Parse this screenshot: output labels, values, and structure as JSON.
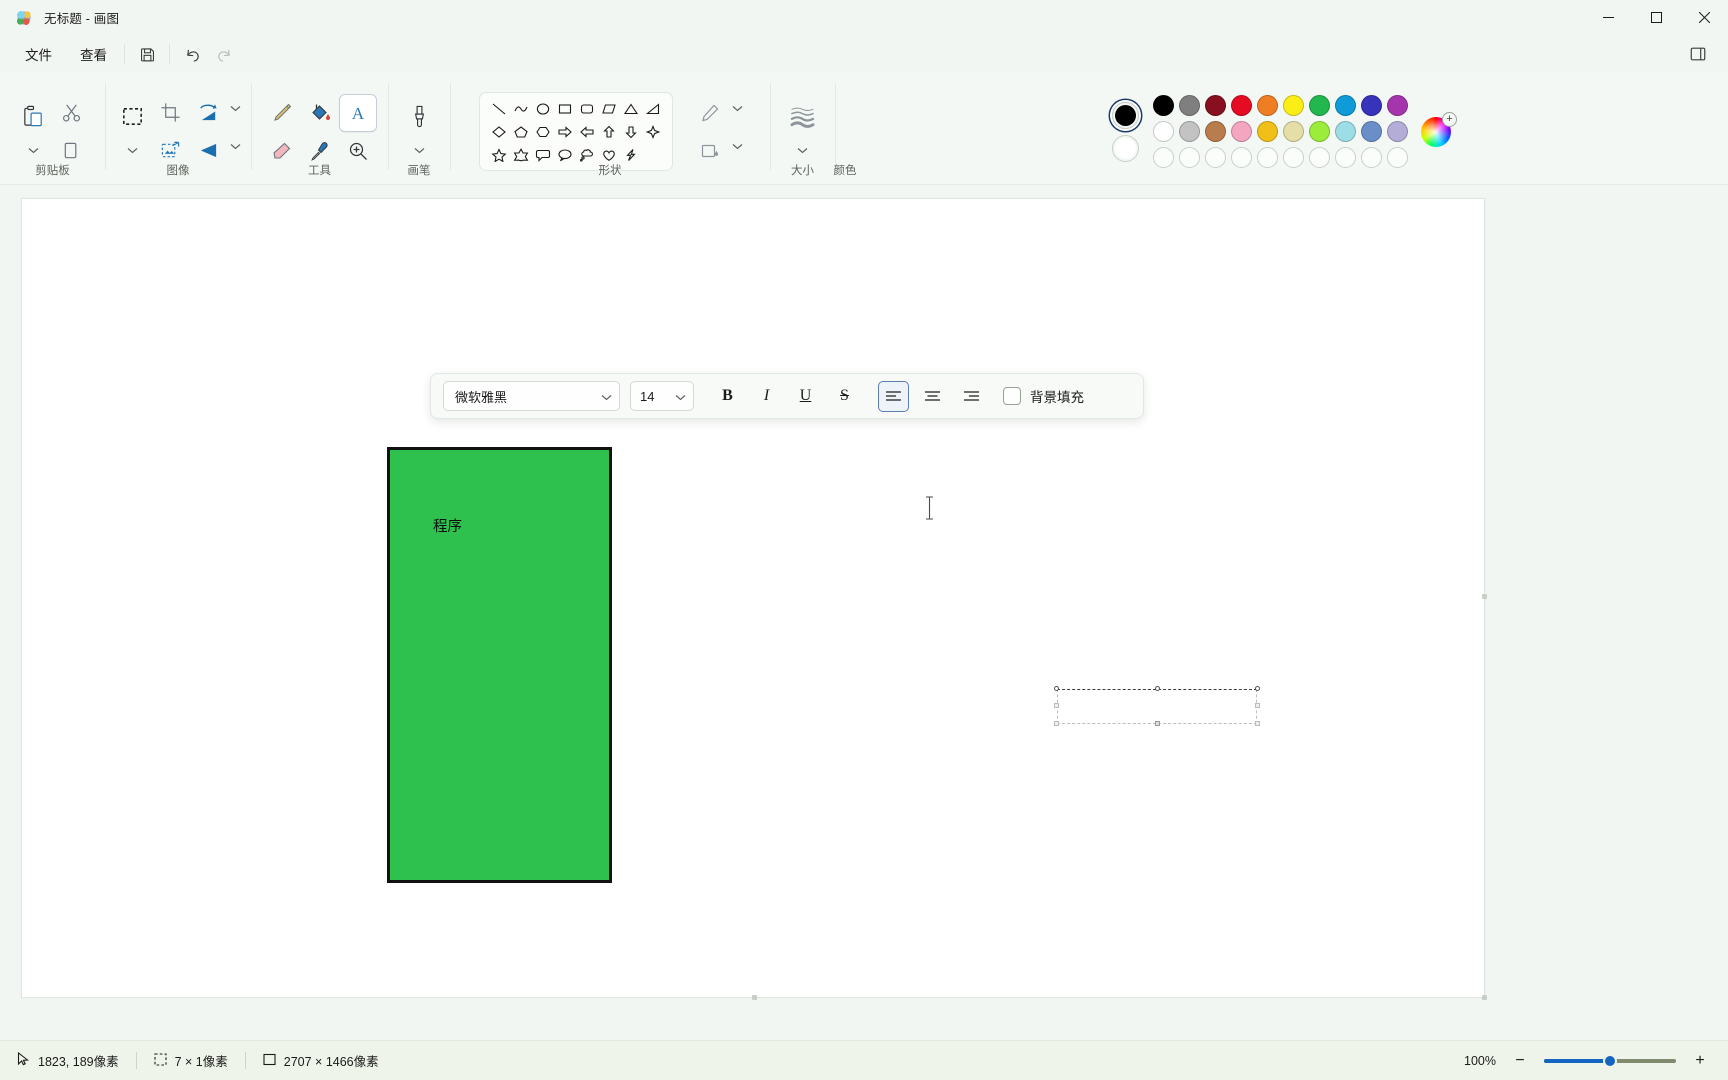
{
  "window": {
    "title": "无标题 - 画图",
    "app_icon": "paint-palette-icon",
    "minimize": "—",
    "maximize": "□",
    "close": "✕"
  },
  "menu": {
    "items": [
      {
        "label": "文件",
        "name": "menu-file"
      },
      {
        "label": "查看",
        "name": "menu-view"
      }
    ],
    "quick_access": [
      {
        "name": "save-icon",
        "label": "保存",
        "disabled": false
      },
      {
        "name": "undo-icon",
        "label": "撤消",
        "disabled": false
      },
      {
        "name": "redo-icon",
        "label": "恢复",
        "disabled": true
      }
    ],
    "right": [
      {
        "name": "collapse-ribbon-icon",
        "label": ""
      }
    ]
  },
  "ribbon": {
    "groups": [
      {
        "label": "剪贴板",
        "name": "group-clipboard",
        "buttons": [
          {
            "name": "paste-icon",
            "label": "粘贴"
          },
          {
            "name": "cut-icon",
            "label": "剪切"
          },
          {
            "name": "copy-icon",
            "label": "复制"
          },
          {
            "name": "paste-dropdown-chevron-icon",
            "label": ""
          }
        ]
      },
      {
        "label": "图像",
        "name": "group-image",
        "buttons": [
          {
            "name": "rect-select-icon",
            "label": "选择"
          },
          {
            "name": "select-dropdown-chevron-icon",
            "label": ""
          },
          {
            "name": "crop-icon",
            "label": "裁剪"
          },
          {
            "name": "resize-icon",
            "label": "调整大小"
          },
          {
            "name": "rotate-icon",
            "label": "旋转"
          },
          {
            "name": "rotate-dropdown-chevron-icon",
            "label": ""
          },
          {
            "name": "flip-icon",
            "label": "翻转"
          },
          {
            "name": "flip-dropdown-chevron-icon",
            "label": ""
          }
        ]
      },
      {
        "label": "工具",
        "name": "group-tools",
        "buttons": [
          {
            "name": "pencil-icon",
            "label": "铅笔"
          },
          {
            "name": "fill-bucket-icon",
            "label": "用颜色填充"
          },
          {
            "name": "text-icon",
            "label": "文本",
            "active": true
          },
          {
            "name": "eraser-icon",
            "label": "橡皮擦"
          },
          {
            "name": "eyedropper-icon",
            "label": "颜色选取器"
          },
          {
            "name": "magnifier-icon",
            "label": "放大镜"
          }
        ]
      },
      {
        "label": "画笔",
        "name": "group-brushes",
        "buttons": [
          {
            "name": "brushes-icon",
            "label": "画笔"
          },
          {
            "name": "brushes-dropdown-chevron-icon",
            "label": ""
          }
        ]
      },
      {
        "label": "形状",
        "name": "group-shapes",
        "shape_rows": [
          [
            "line",
            "curve",
            "oval",
            "rectangle",
            "rounded-rectangle",
            "parallelogram",
            "triangle",
            "right-triangle"
          ],
          [
            "diamond",
            "pentagon",
            "hexagon",
            "right-arrow",
            "left-arrow",
            "up-arrow",
            "down-arrow",
            "four-point-star"
          ],
          [
            "five-point-star",
            "six-point-star",
            "rounded-callout",
            "oval-callout",
            "cloud-callout",
            "heart",
            "lightning"
          ]
        ],
        "buttons": [
          {
            "name": "shape-outline-icon",
            "label": "轮廓"
          },
          {
            "name": "shape-outline-chevron-icon",
            "label": ""
          },
          {
            "name": "shape-fill-icon",
            "label": "填充"
          },
          {
            "name": "shape-fill-chevron-icon",
            "label": ""
          }
        ]
      },
      {
        "label": "大小",
        "name": "group-size",
        "buttons": [
          {
            "name": "size-icon",
            "label": "大小"
          },
          {
            "name": "size-chevron-icon",
            "label": ""
          }
        ]
      },
      {
        "label": "颜色",
        "name": "group-colors"
      }
    ]
  },
  "colors": {
    "primary": "#000000",
    "secondary": "#ffffff",
    "primary_selected": true,
    "row1": [
      "#000000",
      "#7f7f7f",
      "#870f20",
      "#e40b22",
      "#ef7d24",
      "#fbee17",
      "#23b74f",
      "#0e9bd8",
      "#3733bb",
      "#a535ad"
    ],
    "row2": [
      "#ffffff",
      "#c3c3c3",
      "#b97c4c",
      "#f4a5c0",
      "#f0c018",
      "#e5dea7",
      "#9ced3b",
      "#9ddde5",
      "#6a8fc8",
      "#b3add8"
    ],
    "row3": [
      "",
      "",
      "",
      "",
      "",
      "",
      "",
      "",
      "",
      ""
    ],
    "wheel": {
      "name": "color-wheel-icon",
      "badge": "+"
    }
  },
  "text_toolbar": {
    "font_family": "微软雅黑",
    "font_size": "14",
    "bold": {
      "label": "B",
      "name": "bold-button",
      "active": false
    },
    "italic": {
      "label": "I",
      "name": "italic-button",
      "active": false
    },
    "underline": {
      "label": "U",
      "name": "underline-button",
      "active": false
    },
    "strikethrough": {
      "label": "S",
      "name": "strikethrough-button",
      "active": false
    },
    "align_left": {
      "name": "align-left-button",
      "active": true
    },
    "align_center": {
      "name": "align-center-button",
      "active": false
    },
    "align_right": {
      "name": "align-right-button",
      "active": false
    },
    "background_fill": {
      "label": "背景填充",
      "checked": false
    }
  },
  "canvas": {
    "shape": {
      "name": "green-rectangle",
      "fill": "#2ec14e",
      "stroke": "#111111",
      "text": "程序"
    },
    "text_box": {
      "name": "text-entry-box",
      "value": ""
    },
    "cursor": "text-caret-icon"
  },
  "statusbar": {
    "cursor_position": "1823, 189像素",
    "selection_size": "7 × 1像素",
    "image_size": "2707 × 1466像素",
    "zoom_level": "100%",
    "zoom_out": "−",
    "zoom_in": "+",
    "icons": {
      "cursor": "cursor-arrow-icon",
      "selection": "selection-dashed-icon",
      "image": "image-bounds-icon"
    }
  }
}
